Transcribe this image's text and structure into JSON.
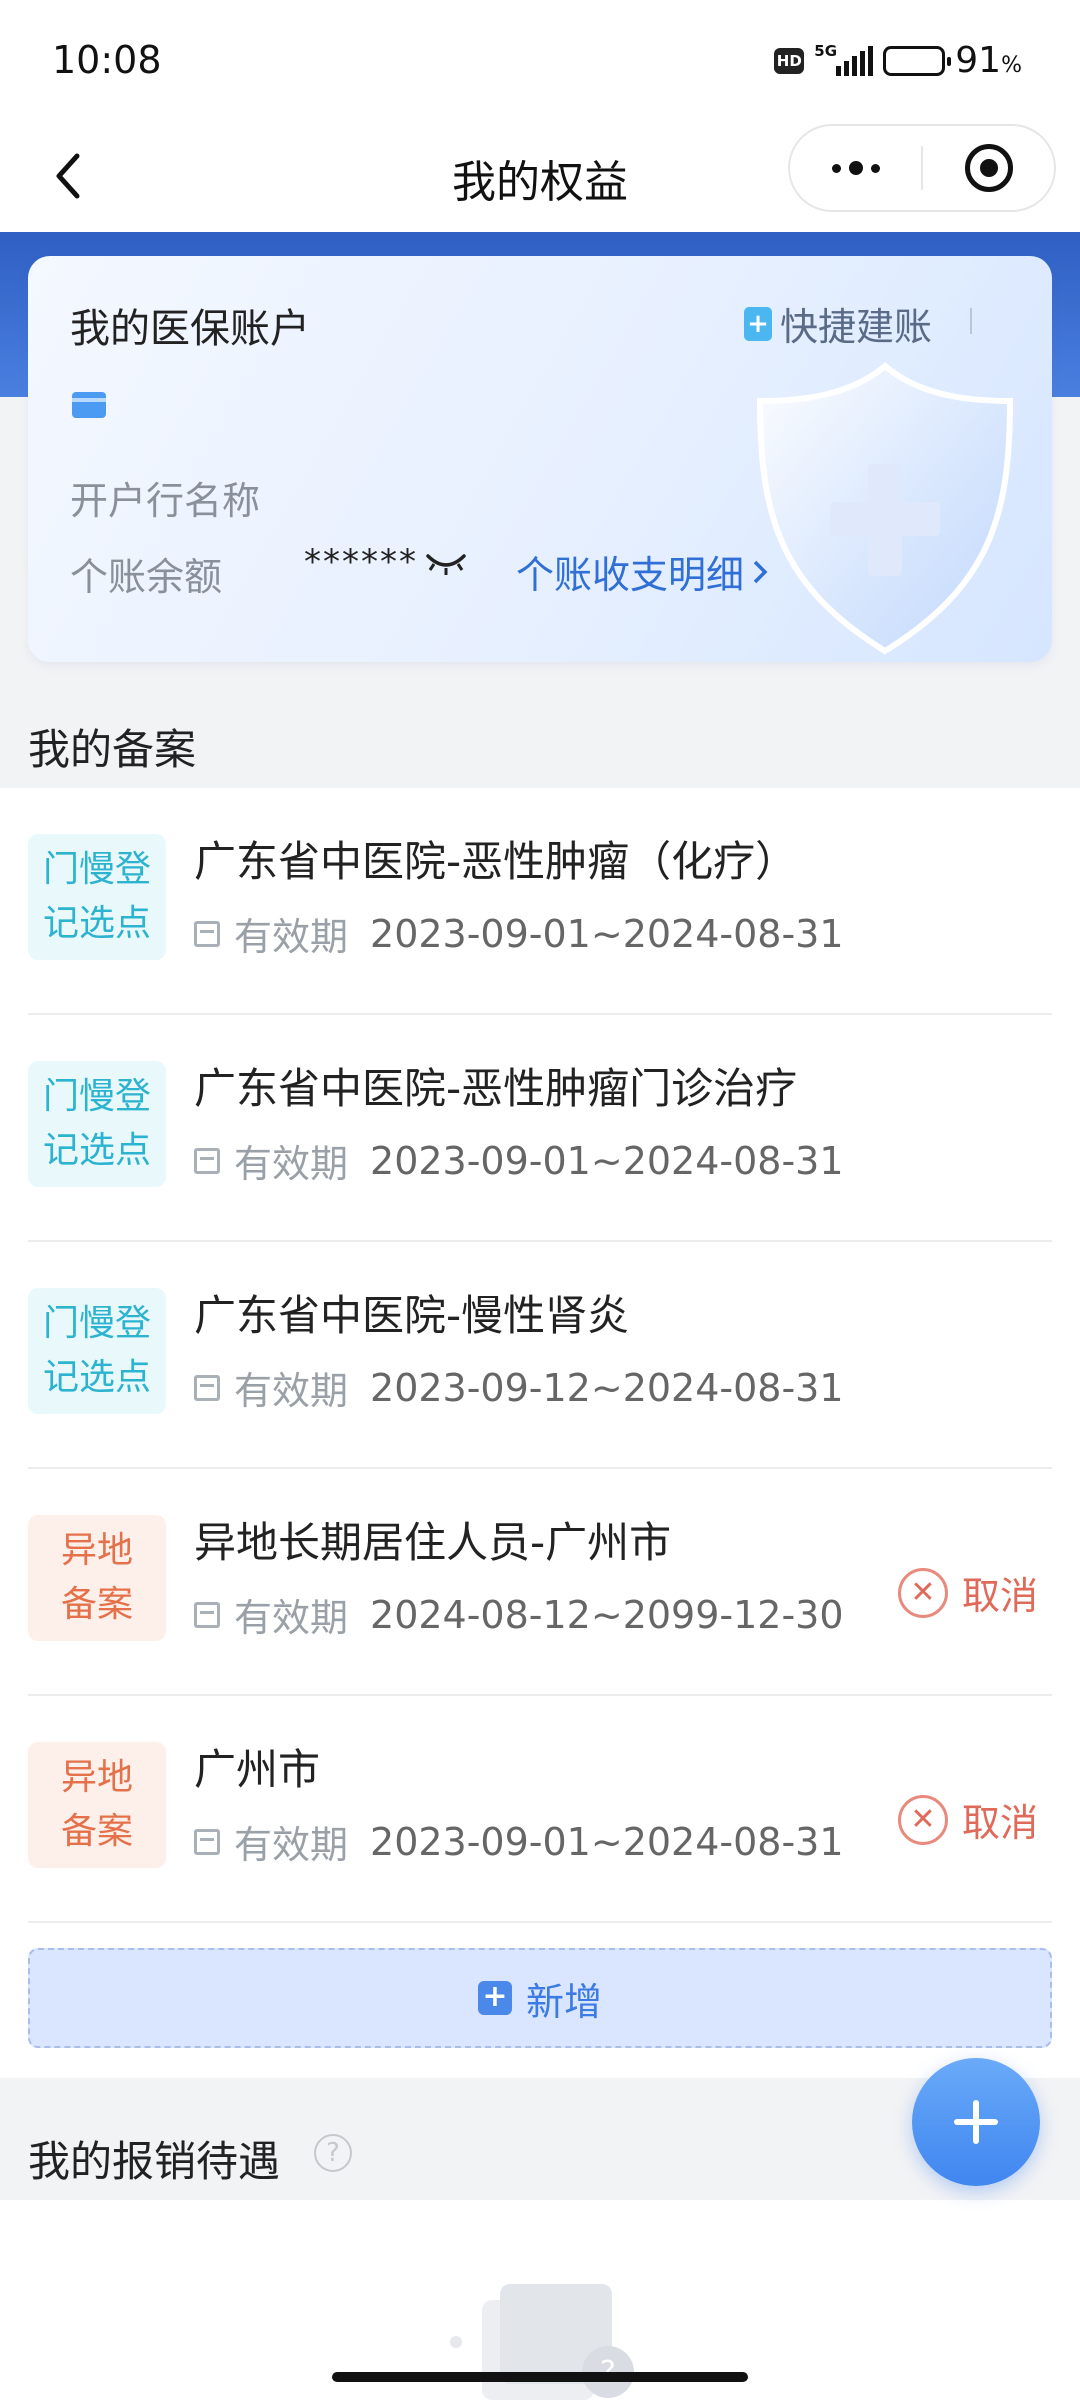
{
  "status_bar": {
    "time": "10:08",
    "hd": "HD",
    "network": "5G",
    "battery_percent": "91",
    "battery_unit": "%",
    "battery_level": 0.91
  },
  "nav": {
    "title": "我的权益"
  },
  "account": {
    "title": "我的医保账户",
    "quick_account_label": "快捷建账",
    "bank_name_label": "开户行名称",
    "balance_label": "个账余额",
    "balance_masked": "******",
    "detail_link": "个账收支明细"
  },
  "records_section": {
    "title": "我的备案",
    "items": [
      {
        "tag_line1": "门慢登",
        "tag_line2": "记选点",
        "title": "广东省中医院-恶性肿瘤（化疗）",
        "valid_label": "有效期",
        "dates": "2023-09-01~2024-08-31"
      },
      {
        "tag_line1": "门慢登",
        "tag_line2": "记选点",
        "title": "广东省中医院-恶性肿瘤门诊治疗",
        "valid_label": "有效期",
        "dates": "2023-09-01~2024-08-31"
      },
      {
        "tag_line1": "门慢登",
        "tag_line2": "记选点",
        "title": "广东省中医院-慢性肾炎",
        "valid_label": "有效期",
        "dates": "2023-09-12~2024-08-31"
      },
      {
        "tag_line1": "异地",
        "tag_line2": "备案",
        "title": "异地长期居住人员-广州市",
        "valid_label": "有效期",
        "dates": "2024-08-12~2099-12-30",
        "cancel_label": "取消"
      },
      {
        "tag_line1": "异地",
        "tag_line2": "备案",
        "title": "广州市",
        "valid_label": "有效期",
        "dates": "2023-09-01~2024-08-31",
        "cancel_label": "取消"
      }
    ],
    "add_label": "新增"
  },
  "reimburse_section": {
    "title": "我的报销待遇"
  },
  "colors": {
    "primary": "#2f6fd6",
    "teal_tag": "#2bb3d0",
    "orange_tag": "#e4714a",
    "cancel": "#e06a5a",
    "header_blue": "#2f5fc2"
  }
}
